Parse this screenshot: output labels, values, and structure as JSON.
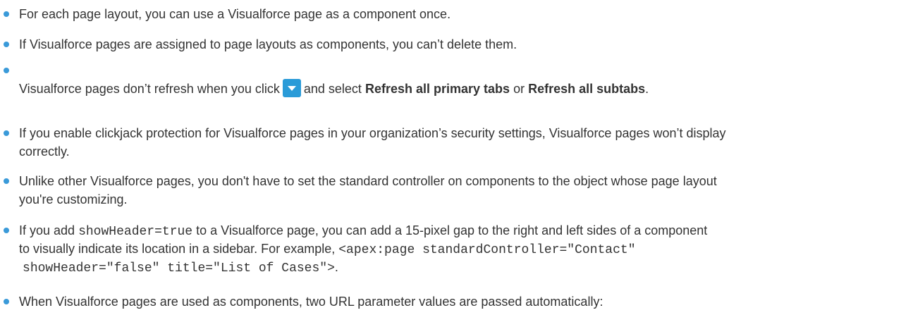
{
  "colors": {
    "bullet": "#3a9ad9",
    "dropdown_icon_bg": "#2a9bd8"
  },
  "icons": {
    "dropdown": "chevron-down-icon"
  },
  "items": [
    {
      "line1": "For each page layout, you can use a Visualforce page as a component once."
    },
    {
      "line1": "If Visualforce pages are assigned to page layouts as components, you can’t delete them."
    },
    {
      "before": "Visualforce pages don’t refresh when you click",
      "middle": "and select",
      "bold1": "Refresh all primary tabs",
      "or": "or",
      "bold2": "Refresh all subtabs",
      "end": "."
    },
    {
      "line1": "If you enable clickjack protection for Visualforce pages in your organization’s security settings, Visualforce pages won’t display",
      "line2": "correctly."
    },
    {
      "line1": "Unlike other Visualforce pages, you don't have to set the standard controller on components to the object whose page layout",
      "line2": "you're customizing."
    },
    {
      "l1_before": "If you add",
      "l1_code": "showHeader=true",
      "l1_after": "to a Visualforce page, you can add a 15-pixel gap to the right and left sides of a component",
      "l2_before": "to visually indicate its location in a sidebar. For example,",
      "l2_code": "<apex:page standardController=\"Contact\"",
      "l3_code": "showHeader=\"false\" title=\"List of Cases\">",
      "l3_after": "."
    },
    {
      "line1": "When Visualforce pages are used as components, two URL parameter values are passed automatically:"
    }
  ]
}
